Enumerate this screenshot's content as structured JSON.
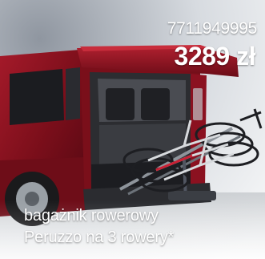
{
  "product": {
    "code": "7711949995",
    "price": "3289 zł",
    "name_line1": "bagażnik rowerowy",
    "name_line2": "Peruzzo na 3 rowery*"
  },
  "colors": {
    "text": "#ffffff",
    "van_red": "#8e1220",
    "background": "#ffffff"
  },
  "image": {
    "icon": "van-with-bike-rack-photo"
  }
}
